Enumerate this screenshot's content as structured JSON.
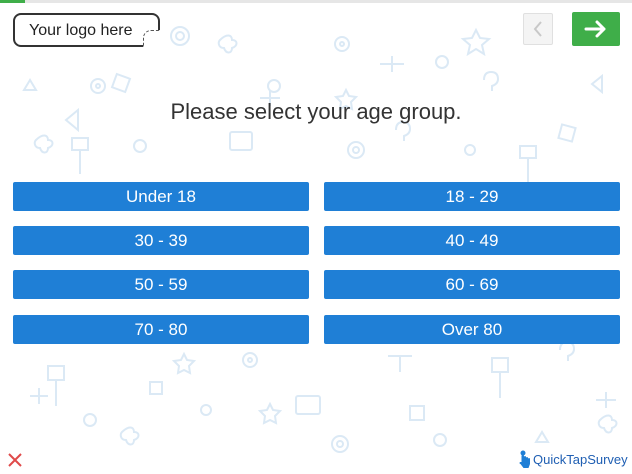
{
  "progress": {
    "value_fraction": 0.04,
    "color": "#3fae49"
  },
  "logo": {
    "text": "Your logo here"
  },
  "navigation": {
    "back_icon": "chevron-left-icon",
    "next_icon": "arrow-right-icon",
    "next_color": "#3fae49"
  },
  "question": {
    "text": "Please select your age group."
  },
  "options": [
    {
      "label": "Under 18"
    },
    {
      "label": "18 - 29"
    },
    {
      "label": "30 - 39"
    },
    {
      "label": "40 - 49"
    },
    {
      "label": "50 - 59"
    },
    {
      "label": "60 - 69"
    },
    {
      "label": "70 - 80"
    },
    {
      "label": "Over 80"
    }
  ],
  "option_color": "#1f7fd6",
  "footer": {
    "close_icon": "close-icon",
    "brand_text": "QuickTapSurvey",
    "brand_icon": "hand-pointer-icon"
  }
}
